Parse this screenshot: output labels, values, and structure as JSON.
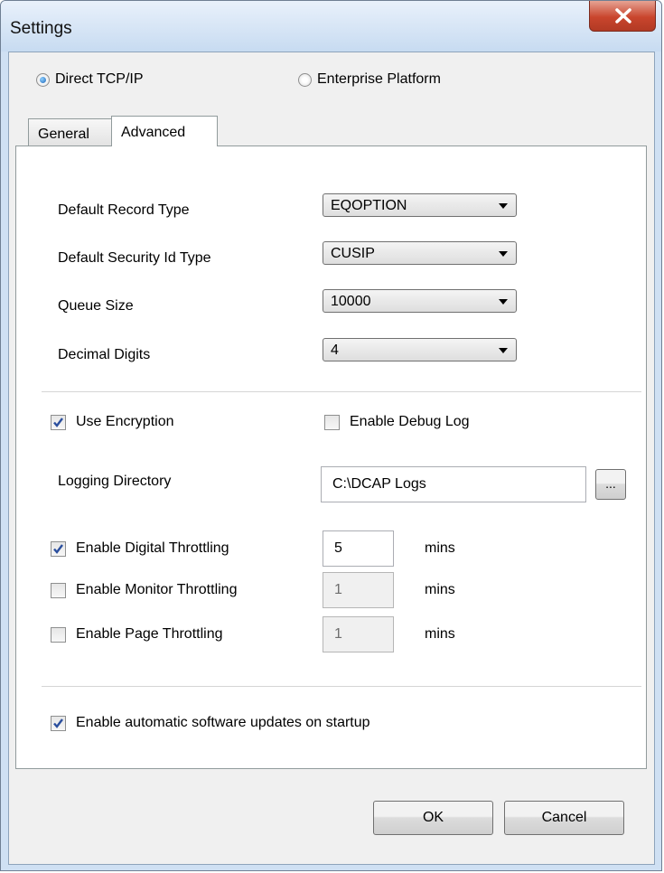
{
  "window": {
    "title": "Settings"
  },
  "connection": {
    "options": [
      {
        "label": "Direct TCP/IP",
        "selected": true
      },
      {
        "label": "Enterprise Platform",
        "selected": false
      }
    ]
  },
  "tabs": [
    {
      "label": "General",
      "active": false
    },
    {
      "label": "Advanced",
      "active": true
    }
  ],
  "advanced": {
    "fields": [
      {
        "label": "Default Record Type",
        "value": "EQOPTION"
      },
      {
        "label": "Default Security Id Type",
        "value": "CUSIP"
      },
      {
        "label": "Queue Size",
        "value": "10000"
      },
      {
        "label": "Decimal Digits",
        "value": "4"
      }
    ],
    "use_encryption": {
      "label": "Use Encryption",
      "checked": true
    },
    "enable_debug_log": {
      "label": "Enable Debug Log",
      "checked": false
    },
    "logging_directory": {
      "label": "Logging Directory",
      "value": "C:\\DCAP Logs",
      "browse_label": "..."
    },
    "throttling": [
      {
        "label": "Enable Digital Throttling",
        "checked": true,
        "value": "5",
        "unit": "mins"
      },
      {
        "label": "Enable Monitor Throttling",
        "checked": false,
        "value": "1",
        "unit": "mins"
      },
      {
        "label": "Enable Page Throttling",
        "checked": false,
        "value": "1",
        "unit": "mins"
      }
    ],
    "auto_update": {
      "label": "Enable automatic software updates on startup",
      "checked": true
    }
  },
  "buttons": {
    "ok": "OK",
    "cancel": "Cancel"
  },
  "colors": {
    "check_mark": "#2b4f9e",
    "radio_dot": "#1f66b8",
    "close_button": "#c9452d"
  }
}
